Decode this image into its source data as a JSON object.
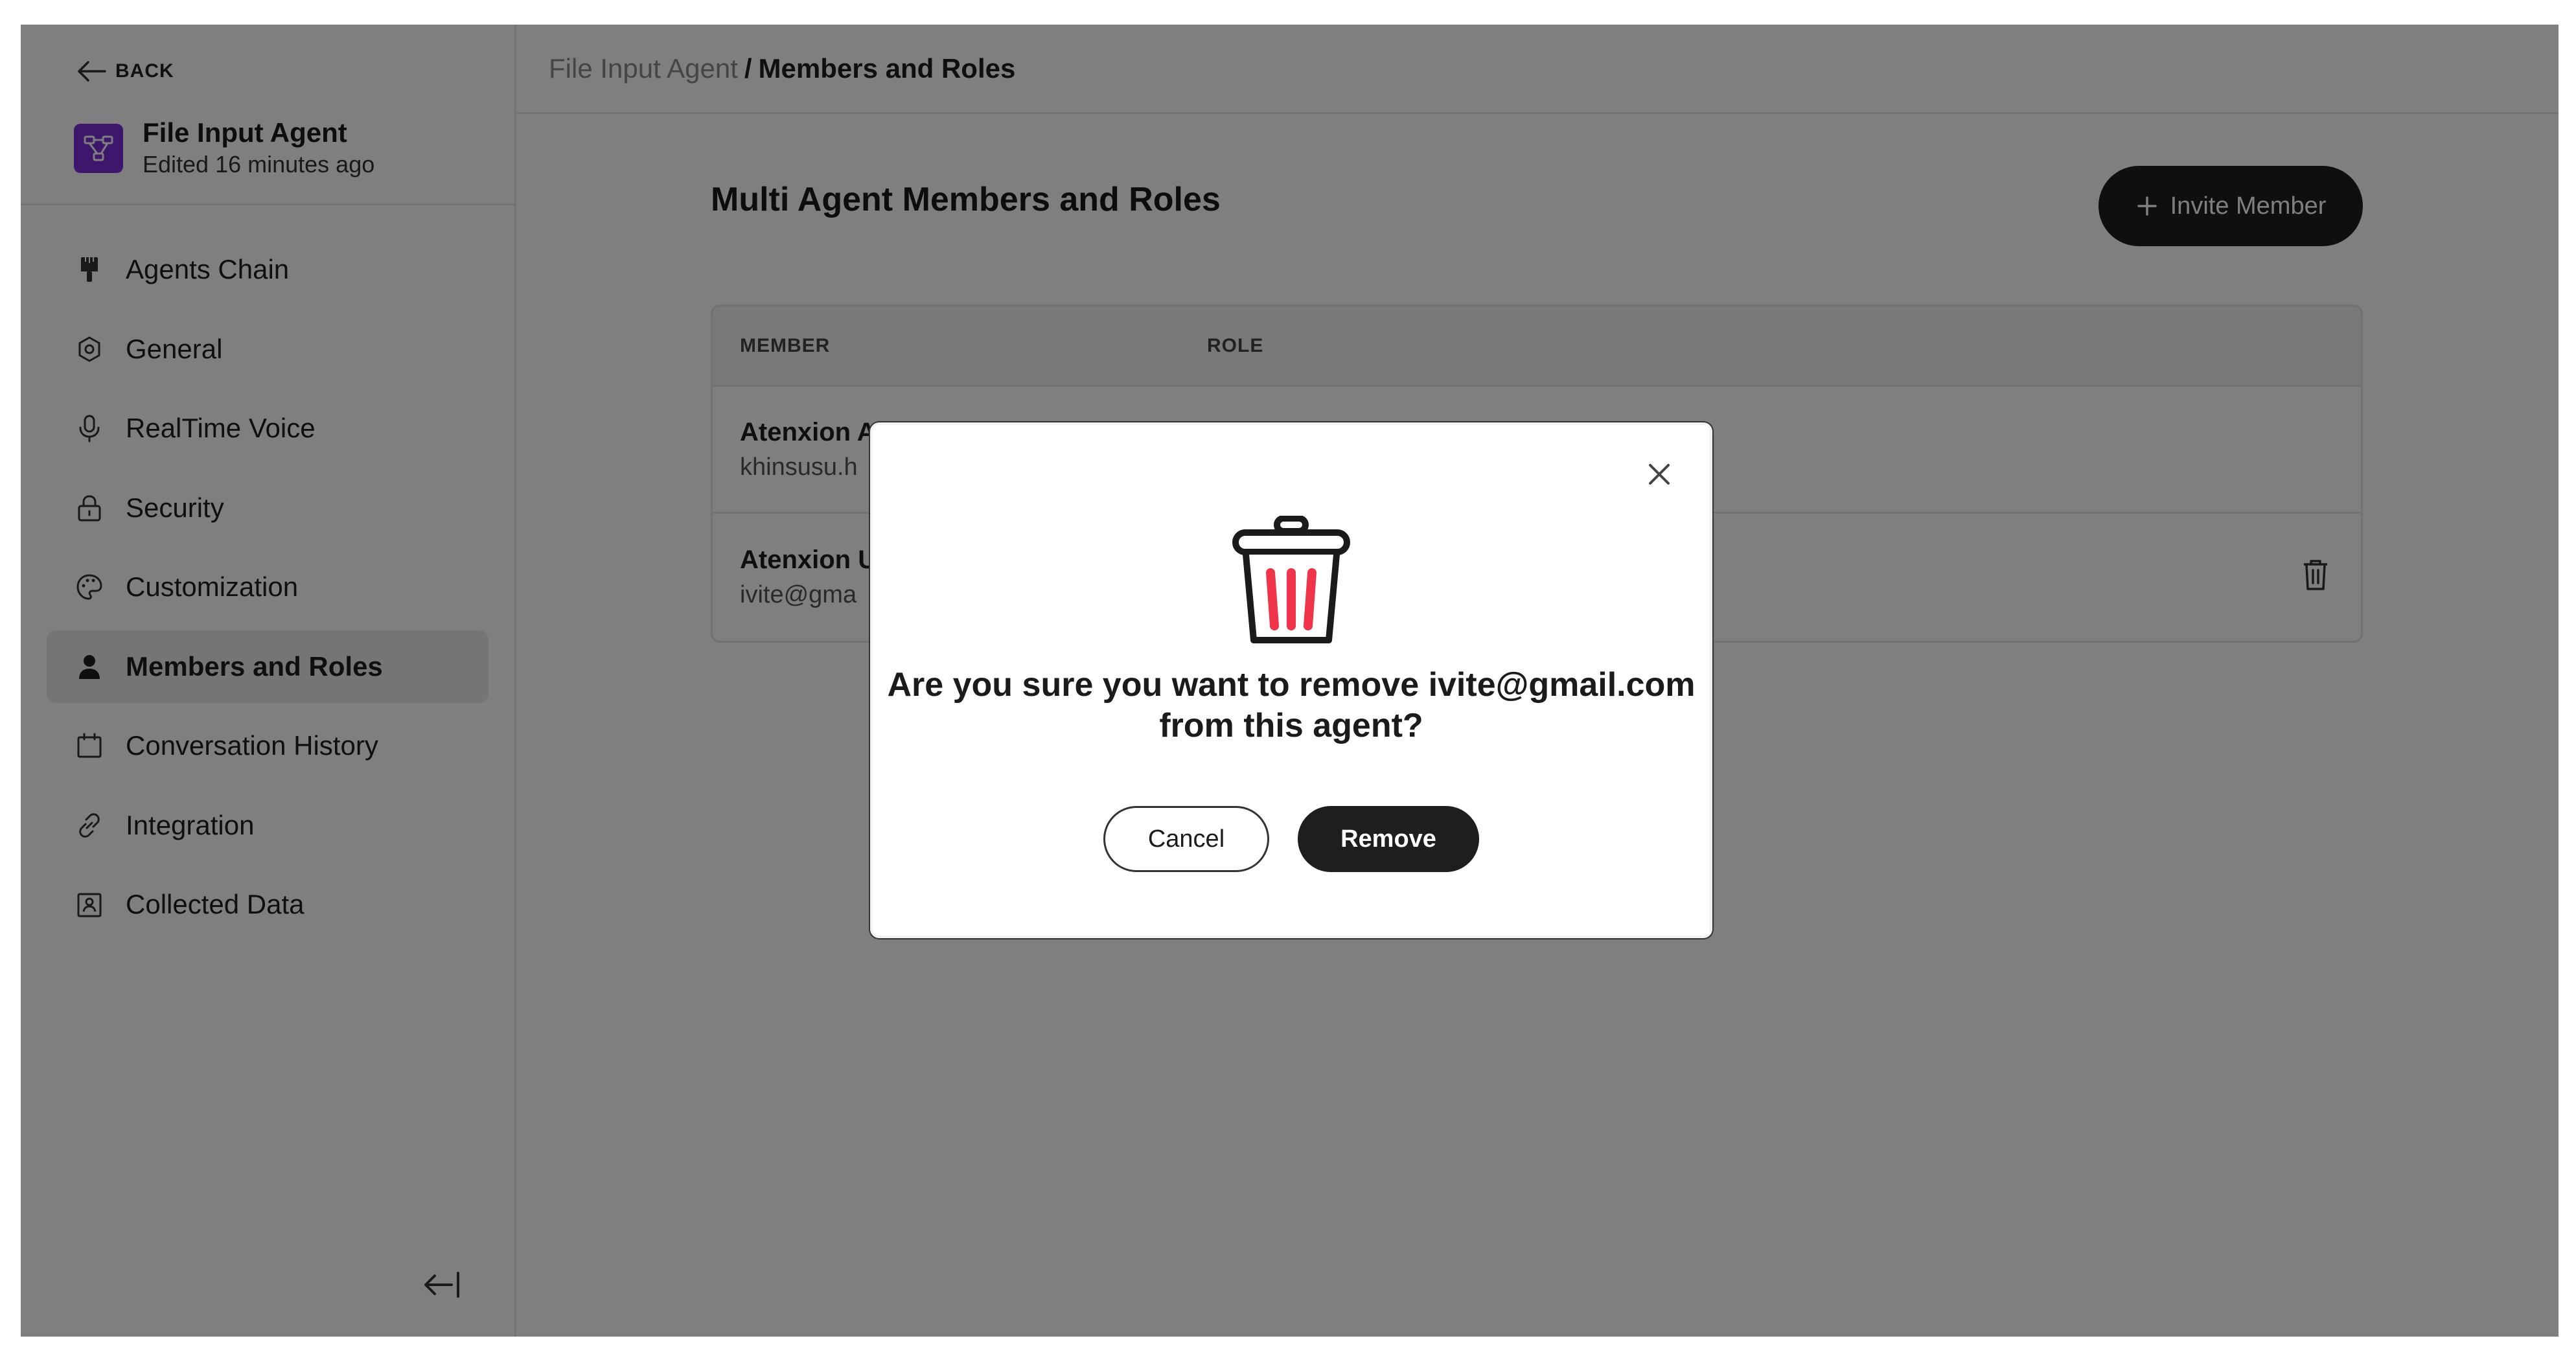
{
  "sidebar": {
    "back_label": "BACK",
    "agent": {
      "name": "File Input Agent",
      "edited": "Edited 16 minutes ago"
    },
    "items": [
      {
        "label": "Agents Chain",
        "icon": "brush-icon",
        "active": false
      },
      {
        "label": "General",
        "icon": "gear-icon",
        "active": false
      },
      {
        "label": "RealTime Voice",
        "icon": "microphone-icon",
        "active": false
      },
      {
        "label": "Security",
        "icon": "lock-icon",
        "active": false
      },
      {
        "label": "Customization",
        "icon": "palette-icon",
        "active": false
      },
      {
        "label": "Members and Roles",
        "icon": "user-icon",
        "active": true
      },
      {
        "label": "Conversation History",
        "icon": "calendar-icon",
        "active": false
      },
      {
        "label": "Integration",
        "icon": "link-icon",
        "active": false
      },
      {
        "label": "Collected Data",
        "icon": "contact-book-icon",
        "active": false
      }
    ]
  },
  "breadcrumb": {
    "parent": "File Input Agent",
    "separator": "/",
    "current": "Members and Roles"
  },
  "page": {
    "title": "Multi Agent Members and Roles",
    "invite_label": "Invite Member"
  },
  "table": {
    "headers": {
      "member": "MEMBER",
      "role": "ROLE"
    },
    "rows": [
      {
        "name": "Atenxion A",
        "email": "khinsusu.h"
      },
      {
        "name": "Atenxion U",
        "email": "ivite@gma"
      }
    ]
  },
  "modal": {
    "line1": "Are you sure you want to remove ivite@gmail.com",
    "line2": "from this agent?",
    "cancel_label": "Cancel",
    "remove_label": "Remove"
  },
  "colors": {
    "accent_dark": "#1e1e1e",
    "agent_logo": "#7b2fd6",
    "trash_stripes": "#f0344a",
    "overlay": "rgba(0,0,0,0.5)"
  }
}
